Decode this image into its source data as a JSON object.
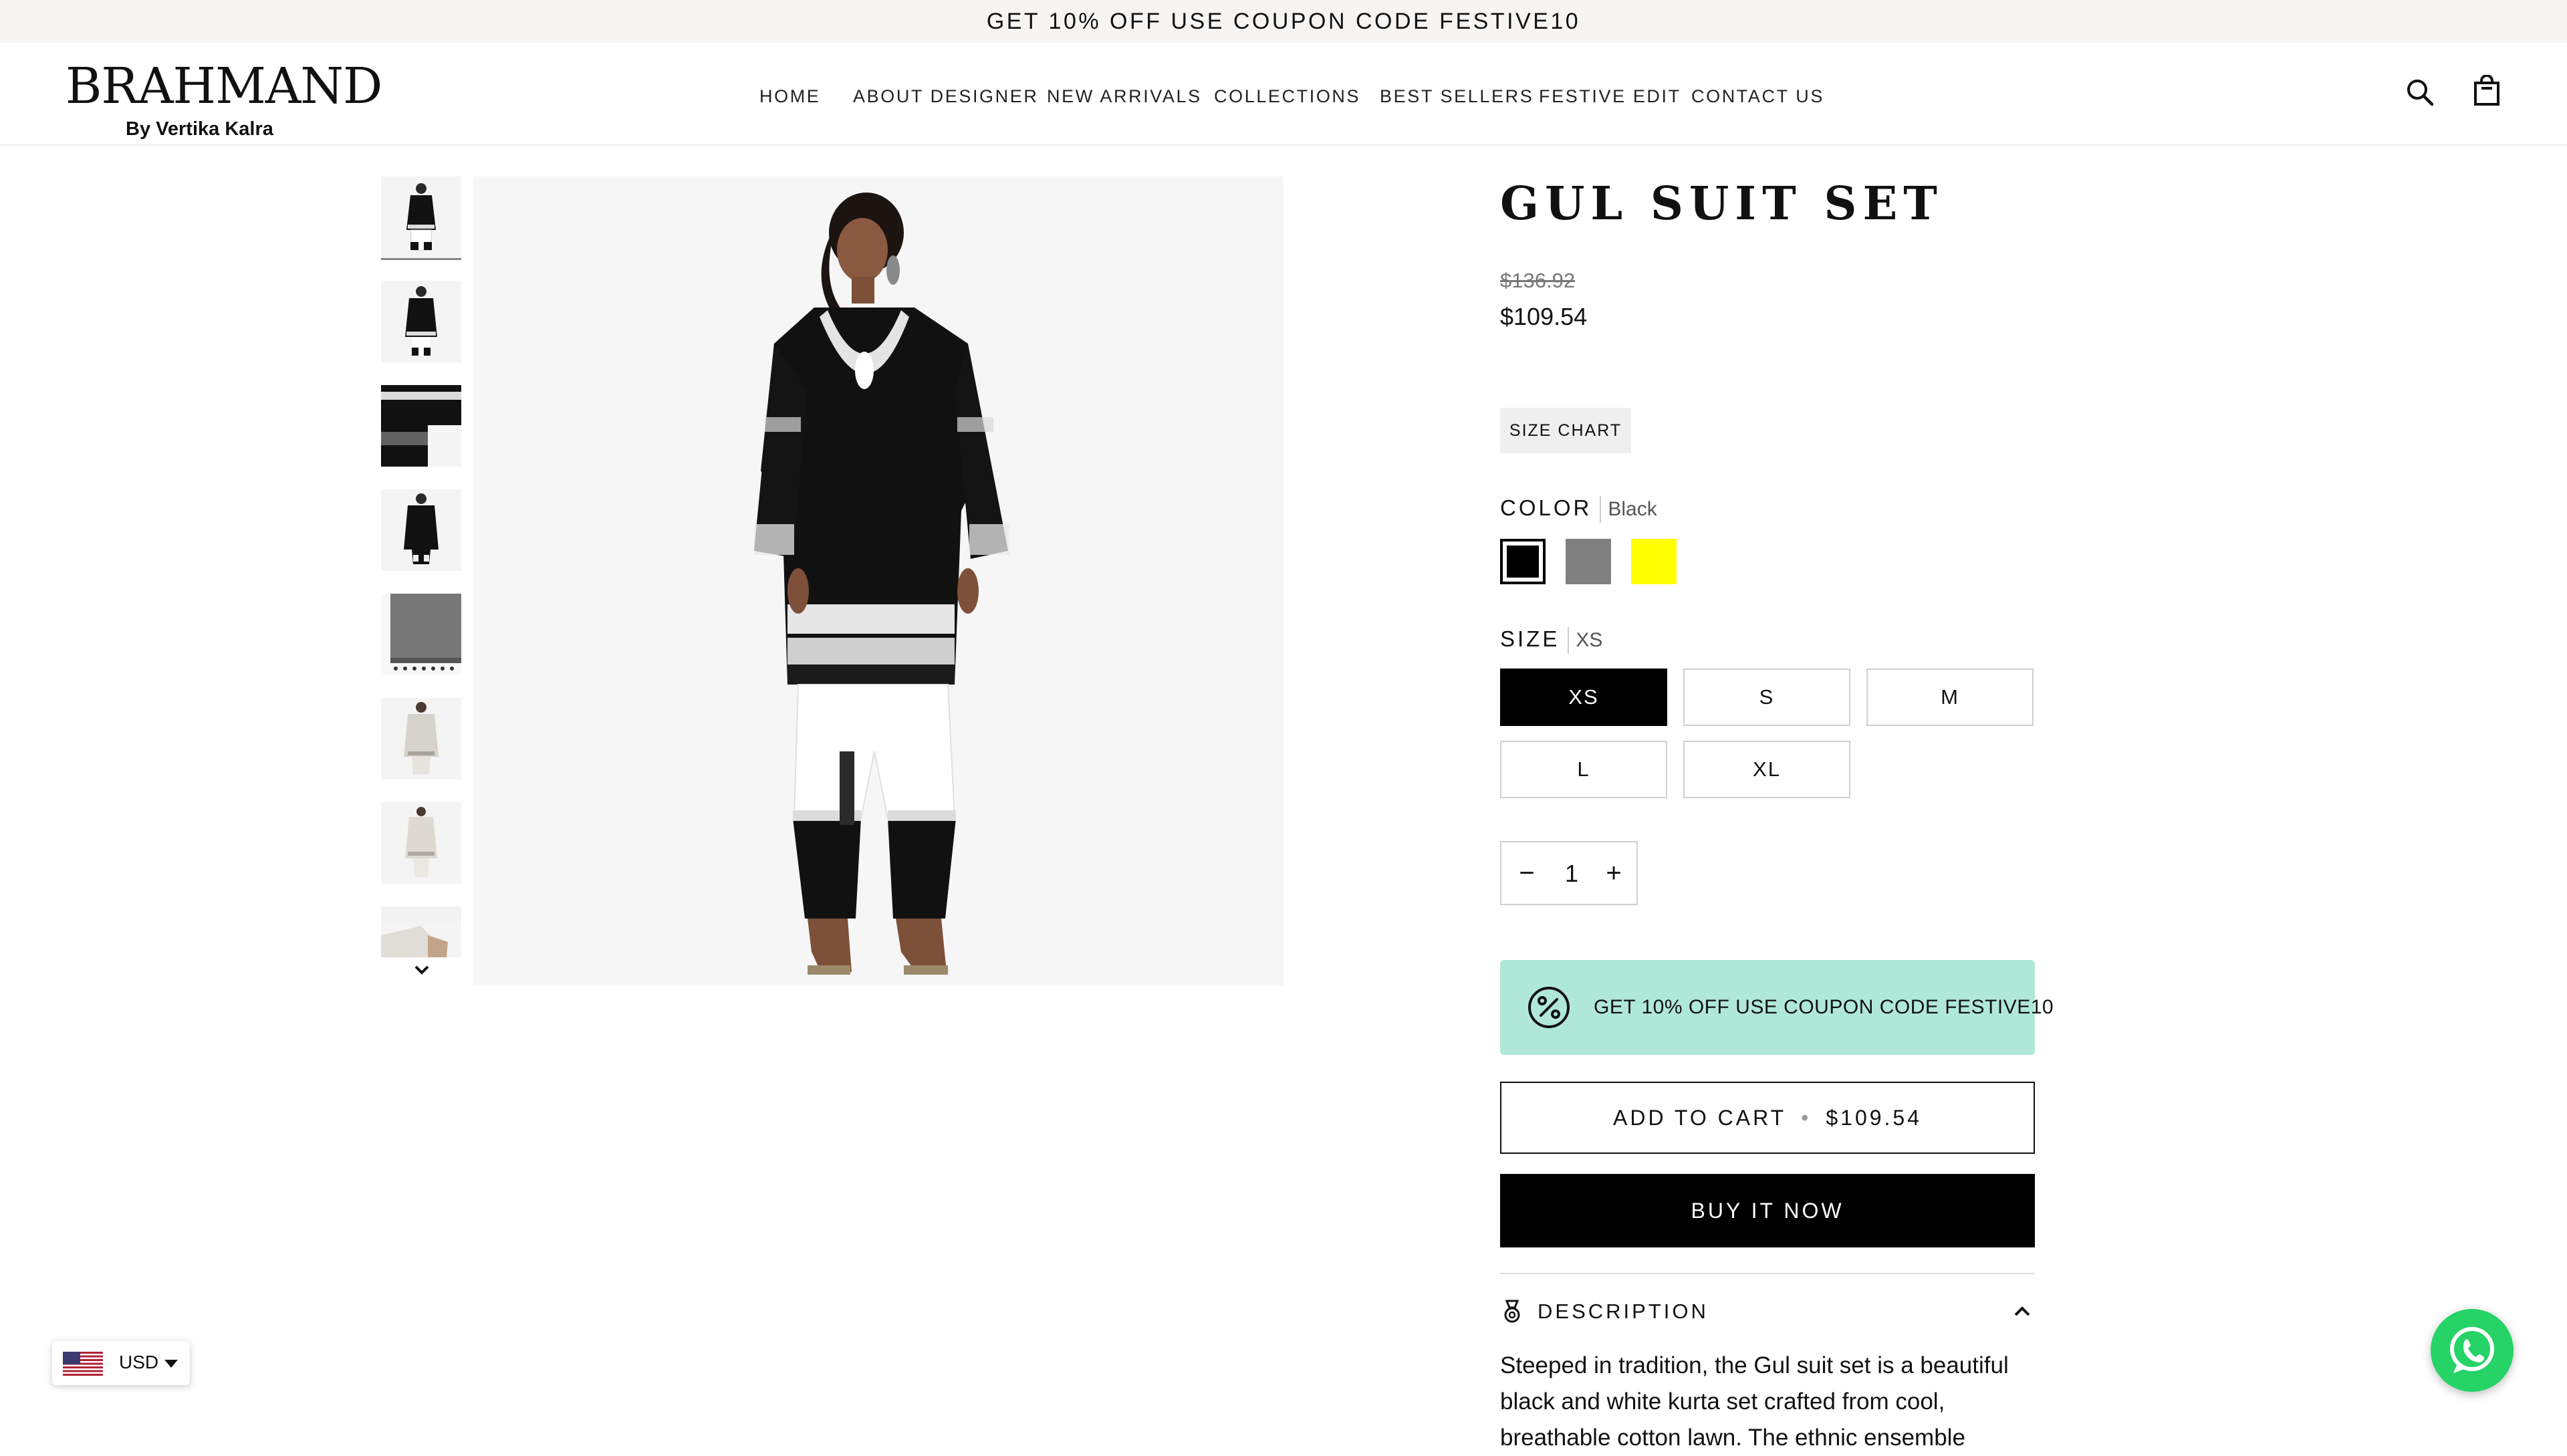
{
  "announcement": "GET 10% OFF USE COUPON CODE FESTIVE10",
  "brand": {
    "name": "BRAHMAND",
    "tagline": "By Vertika Kalra"
  },
  "nav": [
    "HOME",
    "ABOUT DESIGNER",
    "NEW ARRIVALS",
    "COLLECTIONS",
    "BEST SELLERS",
    "FESTIVE EDIT",
    "CONTACT US"
  ],
  "header_icons": [
    "search-icon",
    "shopping-bag-icon"
  ],
  "gallery": {
    "thumbnail_count": 8,
    "selected_index": 0,
    "more_icon": "chevron-down-icon"
  },
  "product": {
    "title": "GUL SUIT SET",
    "compare_price": "$136.92",
    "price": "$109.54"
  },
  "size_chart_label": "SIZE CHART",
  "color": {
    "label": "COLOR",
    "selected": "Black",
    "swatches": [
      "#000000",
      "#808080",
      "#ffff00"
    ]
  },
  "size": {
    "label": "SIZE",
    "selected": "XS",
    "options": [
      "XS",
      "S",
      "M",
      "L",
      "XL"
    ]
  },
  "quantity": {
    "minus": "−",
    "value": "1",
    "plus": "+"
  },
  "coupon_banner": {
    "text": "GET 10% OFF USE COUPON CODE FESTIVE10",
    "color": "#b0e8d8"
  },
  "add_to_cart": {
    "label": "ADD TO CART",
    "separator": "•",
    "price": "$109.54"
  },
  "buy_now_label": "BUY IT NOW",
  "description": {
    "label": "DESCRIPTION",
    "text": "Steeped in tradition, the Gul suit set is a beautiful black and white kurta set crafted from cool, breathable cotton lawn. The ethnic ensemble"
  },
  "currency": {
    "code": "USD"
  },
  "whatsapp_color": "#25d366"
}
